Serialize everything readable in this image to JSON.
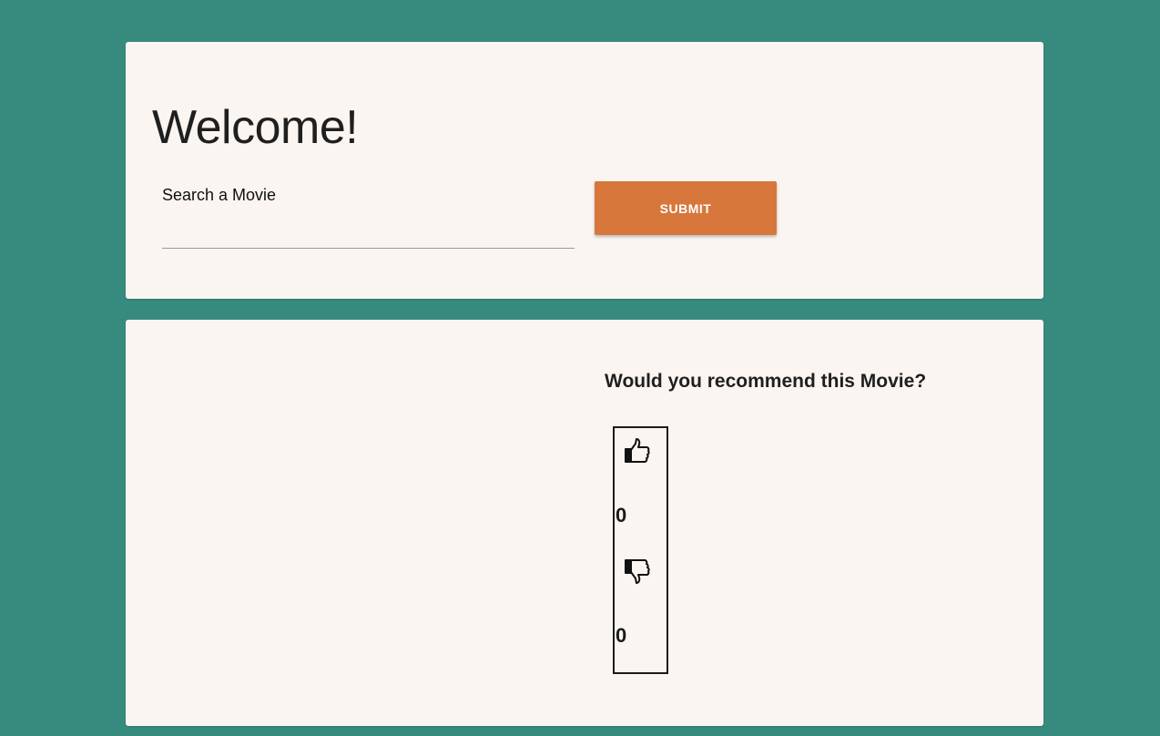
{
  "header": {
    "title": "Welcome!"
  },
  "search": {
    "label": "Search a Movie",
    "value": "",
    "placeholder": "",
    "submit_label": "SUBMIT"
  },
  "recommend": {
    "question": "Would you recommend this Movie?",
    "thumbs_up_icon": "thumbs-up-icon",
    "thumbs_down_icon": "thumbs-down-icon",
    "up_count": "0",
    "down_count": "0"
  },
  "colors": {
    "background": "#378a7e",
    "card": "#faf5f1",
    "accent": "#d7773b"
  }
}
